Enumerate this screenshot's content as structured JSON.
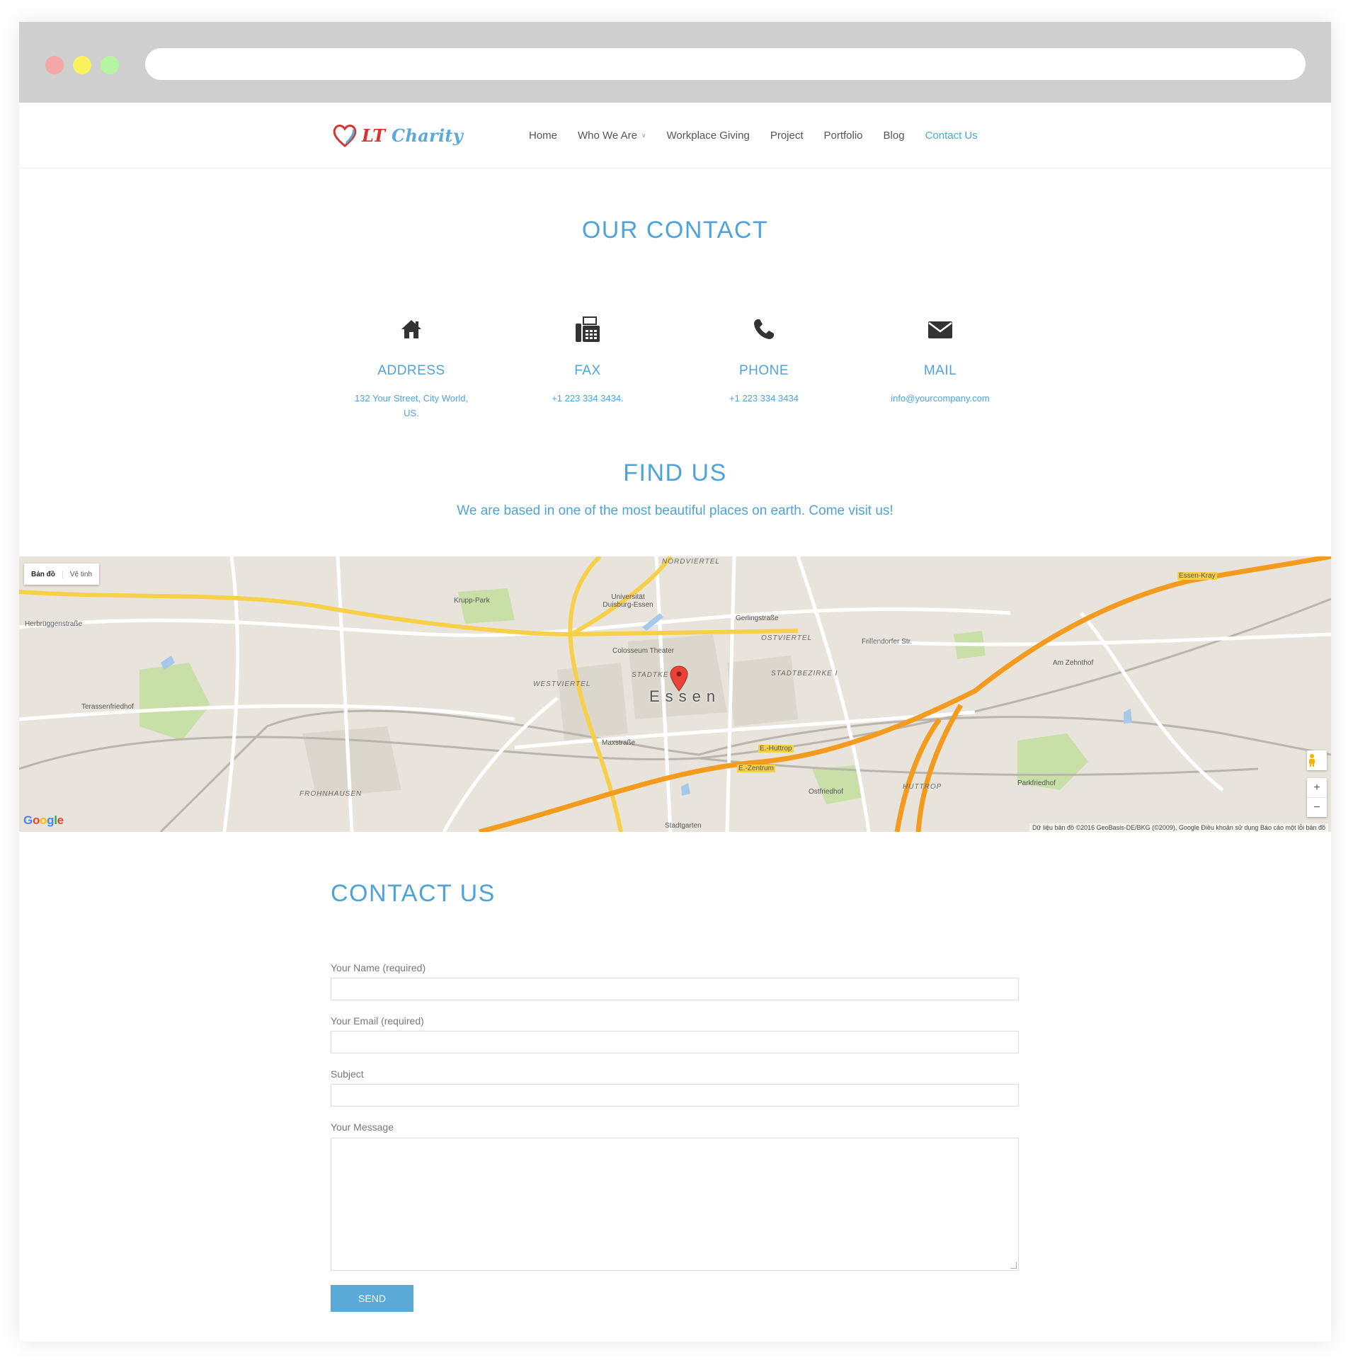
{
  "nav": {
    "logo": {
      "prefix": "LT",
      "name": "Charity"
    },
    "items": [
      {
        "label": "Home"
      },
      {
        "label": "Who We Are"
      },
      {
        "label": "Workplace Giving"
      },
      {
        "label": "Project"
      },
      {
        "label": "Portfolio"
      },
      {
        "label": "Blog"
      },
      {
        "label": "Contact Us"
      }
    ],
    "active": "Contact Us"
  },
  "our_contact": {
    "title": "OUR CONTACT",
    "cards": [
      {
        "icon": "home-icon",
        "label": "ADDRESS",
        "value_line1": "132 Your Street, City World,",
        "value_line2": "US."
      },
      {
        "icon": "fax-icon",
        "label": "FAX",
        "value_line1": "+1 223 334 3434."
      },
      {
        "icon": "phone-icon",
        "label": "PHONE",
        "value_line1": "+1 223 334 3434"
      },
      {
        "icon": "mail-icon",
        "label": "MAIL",
        "value_line1": "info@yourcompany.com"
      }
    ]
  },
  "find_us": {
    "title": "FIND US",
    "subtitle": "We are based in one of the most beautiful places on earth. Come visit us!"
  },
  "map": {
    "type_map": "Bản đồ",
    "type_satellite": "Vệ tinh",
    "city": "Essen",
    "google": "Google",
    "attribution": "Dữ liệu bản đồ ©2016 GeoBasis-DE/BKG (©2009), Google   Điều khoản sử dụng   Báo cáo một lỗi bản đồ",
    "zoom_in": "+",
    "zoom_out": "−",
    "labels": {
      "nordviertel": "NORDVIERTEL",
      "ostviertel": "OSTVIERTEL",
      "westviertel": "WESTVIERTEL",
      "stadtbezirke": "STADTBEZIRKE I",
      "stadtke": "STADTKE",
      "frohnhausen": "FROHNHAUSEN",
      "huttrop": "HUTTROP",
      "krupp_park": "Krupp-Park",
      "universitat": "Universität Duisburg-Essen",
      "colosseum": "Colosseum Theater",
      "terassenfriedhof": "Terassenfriedhof",
      "parkfriedhof": "Parkfriedhof",
      "ostfriedhof": "Ostfriedhof",
      "stadtgarten": "Stadtgarten",
      "gerlingstrasse": "Gerlingstraße",
      "am_zehnthof": "Am Zehnthof",
      "herbruggenstrasse": "Herbrüggenstraße",
      "maxstrasse": "Maxstraße",
      "frillendorfer": "Frillendorfer Str.",
      "e_huttrop": "E.-Huttrop",
      "e_zentrum": "E.-Zentrum",
      "essen_kray": "Essen-Kray"
    }
  },
  "contact_form": {
    "title": "CONTACT US",
    "name_label": "Your Name (required)",
    "email_label": "Your Email (required)",
    "subject_label": "Subject",
    "message_label": "Your Message",
    "send_label": "SEND"
  },
  "colors": {
    "accent": "#4fa3d9",
    "logo_red": "#d9332d",
    "highway": "#f39b1f",
    "main_road": "#f6d04b",
    "park": "#c8dfa8"
  }
}
